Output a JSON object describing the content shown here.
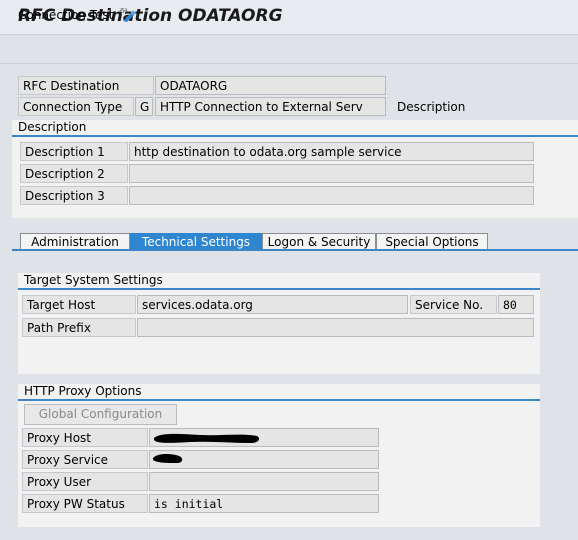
{
  "window": {
    "title": "RFC Destination ODATAORG"
  },
  "toolbar": {
    "connection_test_label": "Connection Test",
    "connection_test_icon": "glasses-icon"
  },
  "header": {
    "rfc_destination_label": "RFC Destination",
    "rfc_destination_value": "ODATAORG",
    "connection_type_label": "Connection Type",
    "connection_type_code": "G",
    "connection_type_value": "HTTP Connection to External Serv",
    "description_label": "Description"
  },
  "description_section": {
    "title": "Description",
    "rows": [
      {
        "label": "Description 1",
        "value": "http destination to odata.org sample service"
      },
      {
        "label": "Description 2",
        "value": ""
      },
      {
        "label": "Description 3",
        "value": ""
      }
    ]
  },
  "tabs": [
    {
      "label": "Administration",
      "active": false
    },
    {
      "label": "Technical Settings",
      "active": true
    },
    {
      "label": "Logon & Security",
      "active": false
    },
    {
      "label": "Special Options",
      "active": false
    }
  ],
  "target_system": {
    "title": "Target System Settings",
    "target_host_label": "Target Host",
    "target_host_value": "services.odata.org",
    "service_no_label": "Service No.",
    "service_no_value": "80",
    "path_prefix_label": "Path Prefix",
    "path_prefix_value": ""
  },
  "proxy": {
    "title": "HTTP Proxy Options",
    "global_config_label": "Global Configuration",
    "proxy_host_label": "Proxy Host",
    "proxy_service_label": "Proxy Service",
    "proxy_user_label": "Proxy User",
    "proxy_user_value": "",
    "proxy_pw_status_label": "Proxy PW Status",
    "proxy_pw_status_value": "is initial"
  },
  "colors": {
    "accent_blue": "#2e86d1",
    "background": "#dfe3e8",
    "panel": "#f2f2f2",
    "redaction": "#000000"
  }
}
